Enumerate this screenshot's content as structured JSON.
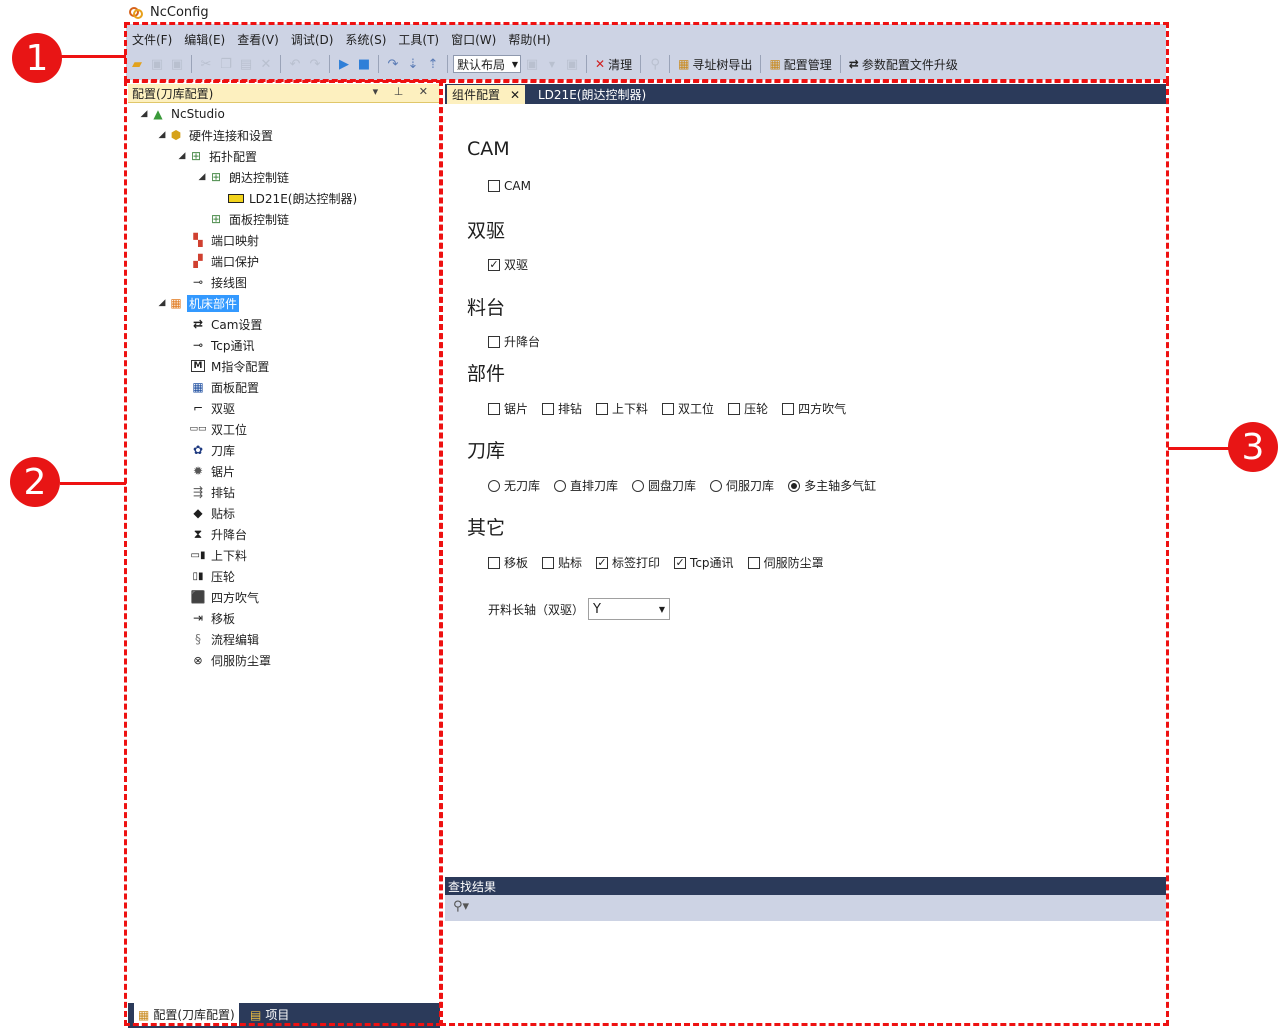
{
  "app": {
    "title": "NcConfig"
  },
  "menu": [
    "文件(F)",
    "编辑(E)",
    "查看(V)",
    "调试(D)",
    "系统(S)",
    "工具(T)",
    "窗口(W)",
    "帮助(H)"
  ],
  "toolbar": {
    "layout_value": "默认布局",
    "clear_label": "清理",
    "export_label": "寻址树导出",
    "config_manage_label": "配置管理",
    "upgrade_label": "参数配置文件升级"
  },
  "left_panel": {
    "title": "配置(刀库配置)",
    "controls": "▾ ⊥ ✕",
    "tree": [
      {
        "label": "NcStudio",
        "icon": "ncstudio-icon"
      },
      {
        "label": "硬件连接和设置",
        "icon": "hardware-icon"
      },
      {
        "label": "拓扑配置",
        "icon": "topology-icon"
      },
      {
        "label": "朗达控制链",
        "icon": "chain-icon"
      },
      {
        "label": "LD21E(朗达控制器)",
        "icon": "controller-icon"
      },
      {
        "label": "面板控制链",
        "icon": "chain-icon"
      },
      {
        "label": "端口映射",
        "icon": "port-map-icon"
      },
      {
        "label": "端口保护",
        "icon": "port-protect-icon"
      },
      {
        "label": "接线图",
        "icon": "wiring-icon"
      },
      {
        "label": "机床部件",
        "icon": "machine-parts-icon"
      },
      {
        "label": "Cam设置",
        "icon": "cam-icon"
      },
      {
        "label": "Tcp通讯",
        "icon": "tcp-icon"
      },
      {
        "label": "M指令配置",
        "icon": "m-command-icon"
      },
      {
        "label": "面板配置",
        "icon": "panel-icon"
      },
      {
        "label": "双驱",
        "icon": "dual-drive-icon"
      },
      {
        "label": "双工位",
        "icon": "dual-station-icon"
      },
      {
        "label": "刀库",
        "icon": "tool-magazine-icon"
      },
      {
        "label": "锯片",
        "icon": "saw-blade-icon"
      },
      {
        "label": "排钻",
        "icon": "drill-row-icon"
      },
      {
        "label": "贴标",
        "icon": "label-icon"
      },
      {
        "label": "升降台",
        "icon": "lift-table-icon"
      },
      {
        "label": "上下料",
        "icon": "load-unload-icon"
      },
      {
        "label": "压轮",
        "icon": "press-wheel-icon"
      },
      {
        "label": "四方吹气",
        "icon": "blow-icon"
      },
      {
        "label": "移板",
        "icon": "move-board-icon"
      },
      {
        "label": "流程编辑",
        "icon": "flow-edit-icon"
      },
      {
        "label": "伺服防尘罩",
        "icon": "dust-cover-icon"
      }
    ],
    "bottom_tabs": [
      "配置(刀库配置)",
      "项目"
    ]
  },
  "doc_tabs": [
    "组件配置",
    "LD21E(朗达控制器)"
  ],
  "sections": {
    "cam": {
      "title": "CAM",
      "options": [
        {
          "label": "CAM",
          "checked": false
        }
      ]
    },
    "dual": {
      "title": "双驱",
      "options": [
        {
          "label": "双驱",
          "checked": true
        }
      ]
    },
    "table": {
      "title": "料台",
      "options": [
        {
          "label": "升降台",
          "checked": false
        }
      ]
    },
    "parts": {
      "title": "部件",
      "options": [
        {
          "label": "锯片",
          "checked": false
        },
        {
          "label": "排钻",
          "checked": false
        },
        {
          "label": "上下料",
          "checked": false
        },
        {
          "label": "双工位",
          "checked": false
        },
        {
          "label": "压轮",
          "checked": false
        },
        {
          "label": "四方吹气",
          "checked": false
        }
      ]
    },
    "magazine": {
      "title": "刀库",
      "options": [
        {
          "label": "无刀库",
          "checked": false
        },
        {
          "label": "直排刀库",
          "checked": false
        },
        {
          "label": "圆盘刀库",
          "checked": false
        },
        {
          "label": "伺服刀库",
          "checked": false
        },
        {
          "label": "多主轴多气缸",
          "checked": true
        }
      ]
    },
    "other": {
      "title": "其它",
      "options": [
        {
          "label": "移板",
          "checked": false
        },
        {
          "label": "贴标",
          "checked": false
        },
        {
          "label": "标签打印",
          "checked": true
        },
        {
          "label": "Tcp通讯",
          "checked": true
        },
        {
          "label": "伺服防尘罩",
          "checked": false
        }
      ]
    }
  },
  "axis": {
    "label": "开料长轴（双驱）",
    "value": "Y"
  },
  "find": {
    "title": "查找结果"
  },
  "callouts": [
    "1",
    "2",
    "3"
  ],
  "colors": {
    "annotation_red": "#ee1111",
    "selection_blue": "#3399ff",
    "navy": "#2b3a5a",
    "toolbar_bg": "#cdd3e4"
  }
}
